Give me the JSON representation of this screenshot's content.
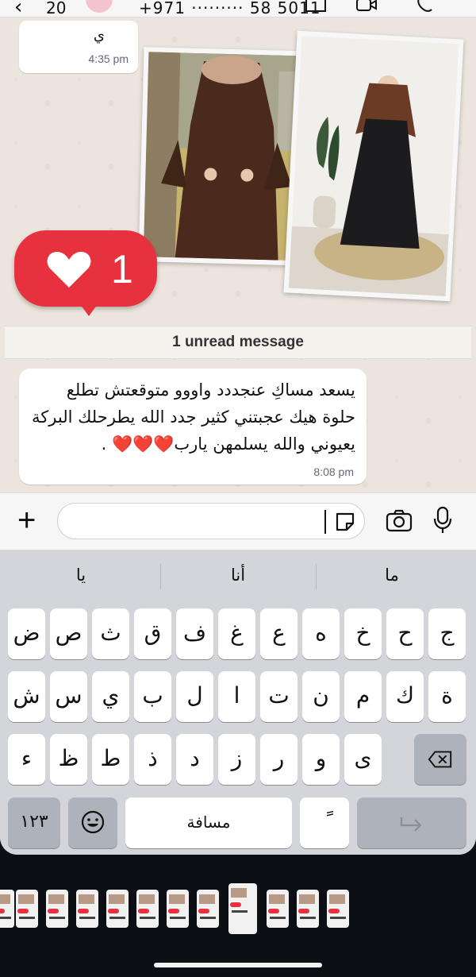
{
  "header": {
    "back_count": "20",
    "phone_partial": "+971 ········· 58 5011"
  },
  "chat": {
    "prev_message_fragment": "ي",
    "prev_message_time": "4:35 pm",
    "reaction": {
      "emoji": "heart",
      "count": "1",
      "color": "#e8313f"
    },
    "unread_label": "1 unread message",
    "message": {
      "text": "يسعد مساكِ عنجددد واووو متوقعتش تطلع حلوة هيك عجبتني كثير جدد الله يطرحلك البركة يعيوني والله يسلمهن يارب❤️❤️❤️ .",
      "time": "8:08 pm"
    }
  },
  "input": {
    "placeholder": ""
  },
  "keyboard": {
    "suggestions": [
      "يا",
      "أنا",
      "ما"
    ],
    "row1": [
      "ض",
      "ص",
      "ث",
      "ق",
      "ف",
      "غ",
      "ع",
      "ه",
      "خ",
      "ح",
      "ج"
    ],
    "row2": [
      "ش",
      "س",
      "ي",
      "ب",
      "ل",
      "ا",
      "ت",
      "ن",
      "م",
      "ك",
      "ة"
    ],
    "row3": [
      "ء",
      "ظ",
      "ط",
      "ذ",
      "د",
      "ز",
      "ر",
      "و",
      "ى"
    ],
    "numbers_key": "١٢٣",
    "space_label": "مسافة",
    "diacritic_key": "ً"
  },
  "colors": {
    "chat_bg": "#ece5dd",
    "bubble": "#ffffff",
    "reaction": "#e8313f",
    "keyboard_bg": "#d3d5db"
  }
}
